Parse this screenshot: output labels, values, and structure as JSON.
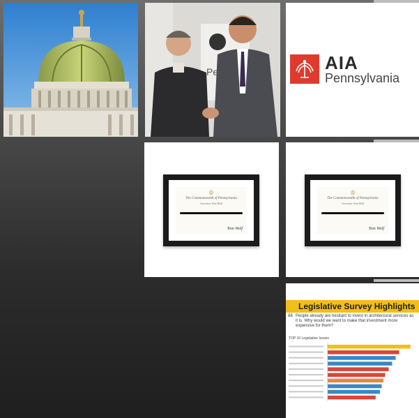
{
  "gallery": {
    "aia": {
      "title": "AIA",
      "subtitle": "Pennsylvania"
    },
    "certificate": {
      "seal": "♔",
      "line1": "The Commonwealth of Pennsylvania",
      "line2": "Governor Tom Wolf",
      "signature": "Tom Wolf"
    },
    "survey": {
      "title": "Legislative Survey Highlights",
      "quote": "People already are hesitant to invest in architectural services as it is. Why would we want to make that investment more expensive for them?",
      "top10_label": "TOP 10 Legislative Issues"
    },
    "colors": {
      "aia_red": "#e03a2f",
      "survey_yellow": "#f2bf19"
    }
  },
  "chart_data": {
    "type": "bar",
    "title": "TOP 10 Legislative Issues",
    "categories": [
      "",
      "",
      "",
      "",
      "",
      "",
      "",
      "",
      "",
      ""
    ],
    "values": [
      95,
      82,
      78,
      74,
      70,
      66,
      64,
      62,
      60,
      55
    ],
    "colors": [
      "#f2bf19",
      "#d9453a",
      "#3a87c8",
      "#3a87c8",
      "#d9453a",
      "#d9453a",
      "#e8864a",
      "#3a87c8",
      "#3a87c8",
      "#d9453a"
    ],
    "xlim": [
      0,
      100
    ]
  }
}
